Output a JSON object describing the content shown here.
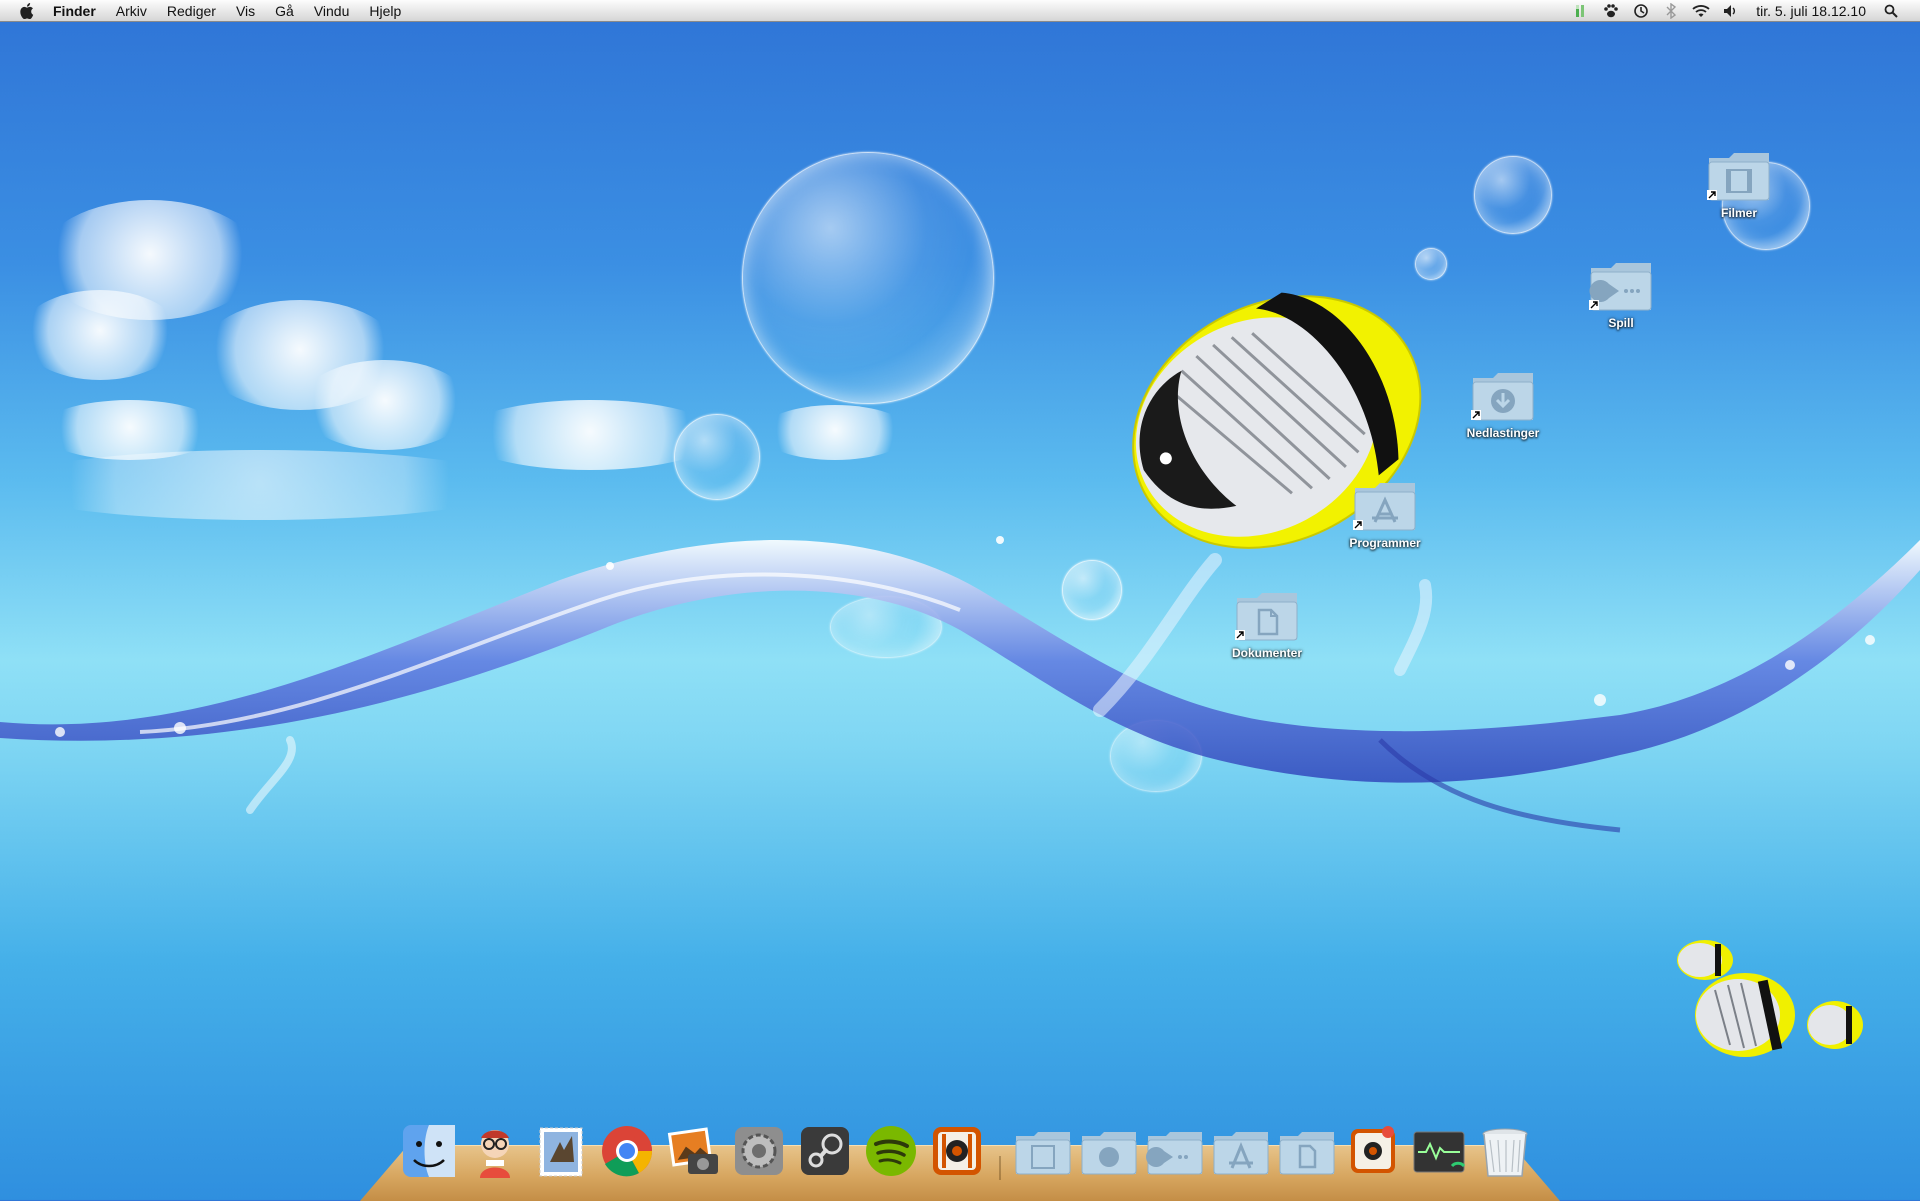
{
  "menubar": {
    "app_name": "Finder",
    "menus": [
      "Arkiv",
      "Rediger",
      "Vis",
      "Gå",
      "Vindu",
      "Hjelp"
    ],
    "clock": "tir. 5. juli  18.12.10",
    "status_icons": [
      "battery-meter-icon",
      "paw-icon",
      "time-machine-icon",
      "bluetooth-icon",
      "wifi-icon",
      "volume-icon"
    ],
    "spotlight_icon": "spotlight-search-icon"
  },
  "desktop": {
    "icons": [
      {
        "label": "Filmer",
        "glyph": "film-icon"
      },
      {
        "label": "Spill",
        "glyph": "pacman-icon"
      },
      {
        "label": "Nedlastinger",
        "glyph": "download-icon"
      },
      {
        "label": "Programmer",
        "glyph": "app-store-icon"
      },
      {
        "label": "Dokumenter",
        "glyph": "document-icon"
      }
    ]
  },
  "dock": {
    "apps": [
      {
        "name": "finder-icon"
      },
      {
        "name": "preview-character-icon"
      },
      {
        "name": "mail-stamp-icon"
      },
      {
        "name": "chrome-icon"
      },
      {
        "name": "iphoto-icon"
      },
      {
        "name": "system-preferences-icon"
      },
      {
        "name": "steam-icon"
      },
      {
        "name": "spotify-icon"
      },
      {
        "name": "transmission-icon"
      }
    ],
    "stacks": [
      {
        "name": "film-stack-icon"
      },
      {
        "name": "download-stack-icon"
      },
      {
        "name": "pacman-stack-icon"
      },
      {
        "name": "applications-stack-icon"
      },
      {
        "name": "documents-stack-icon"
      },
      {
        "name": "transmission-small-icon"
      },
      {
        "name": "activity-monitor-icon"
      },
      {
        "name": "trash-icon"
      }
    ]
  },
  "colors": {
    "sky_top": "#2f74d6",
    "sea_light": "#8fe0f6",
    "folder_blue": "#a9c6dc",
    "dock_wood": "#d7a660"
  }
}
